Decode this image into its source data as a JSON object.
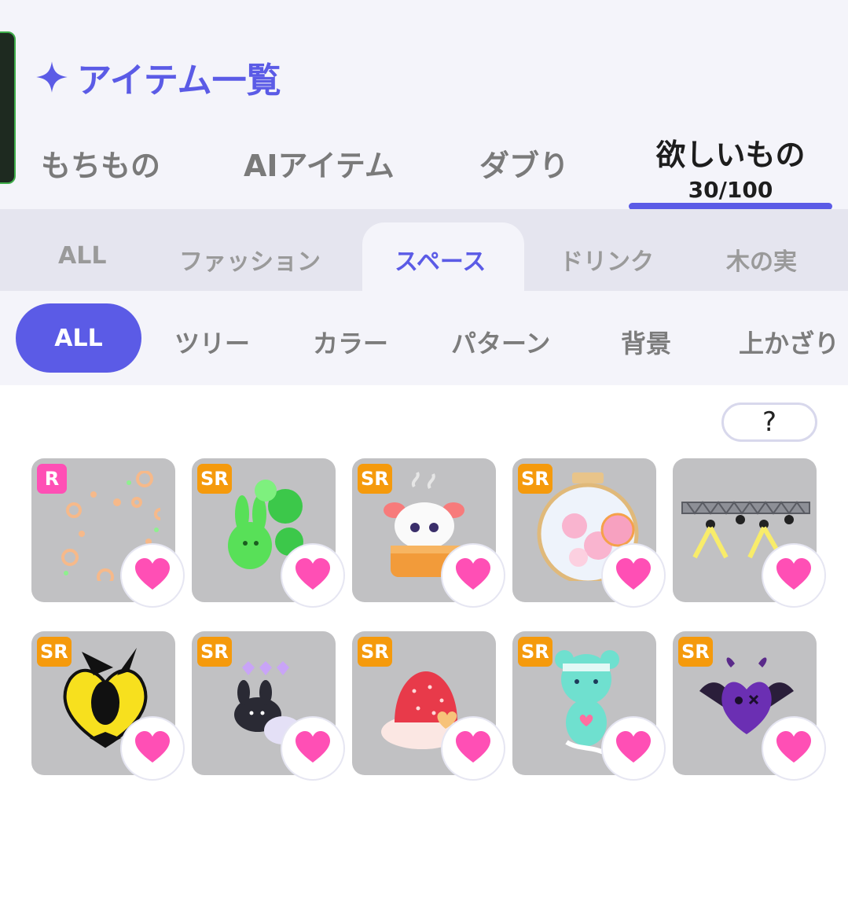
{
  "header": {
    "title": "アイテム一覧",
    "tabs": [
      {
        "label": "もちもの"
      },
      {
        "label": "AIアイテム"
      },
      {
        "label": "ダブり"
      },
      {
        "label": "欲しいもの",
        "count": "30/100",
        "active": true
      }
    ]
  },
  "categories": [
    {
      "label": "ALL"
    },
    {
      "label": "ファッション"
    },
    {
      "label": "スペース",
      "active": true
    },
    {
      "label": "ドリンク"
    },
    {
      "label": "木の実"
    }
  ],
  "subcategories": [
    {
      "label": "ALL",
      "active": true
    },
    {
      "label": "ツリー"
    },
    {
      "label": "カラー"
    },
    {
      "label": "パターン"
    },
    {
      "label": "背景"
    },
    {
      "label": "上かざり"
    }
  ],
  "help_label": "?",
  "items": [
    {
      "rarity": "R",
      "icon": "flower-sparkle-frame",
      "favorited": true
    },
    {
      "rarity": "SR",
      "icon": "green-bunny-clover",
      "favorited": true
    },
    {
      "rarity": "SR",
      "icon": "bun-bath-creature",
      "favorited": true
    },
    {
      "rarity": "SR",
      "icon": "sakura-jar",
      "favorited": true
    },
    {
      "rarity": "SR",
      "icon": "stage-spotlights",
      "favorited": true
    },
    {
      "rarity": "SR",
      "icon": "gold-bee-emblem",
      "favorited": true
    },
    {
      "rarity": "SR",
      "icon": "black-bunny-hearts",
      "favorited": true
    },
    {
      "rarity": "SR",
      "icon": "strawberry-cream",
      "favorited": true
    },
    {
      "rarity": "SR",
      "icon": "mint-bandage-bear",
      "favorited": true
    },
    {
      "rarity": "SR",
      "icon": "purple-devil-heart",
      "favorited": true
    }
  ],
  "colors": {
    "accent": "#5b5be6",
    "heart": "#ff4fb5",
    "badge_sr": "#f59a0c",
    "badge_r": "#ff4fb5",
    "card_bg": "#c1c1c3"
  }
}
